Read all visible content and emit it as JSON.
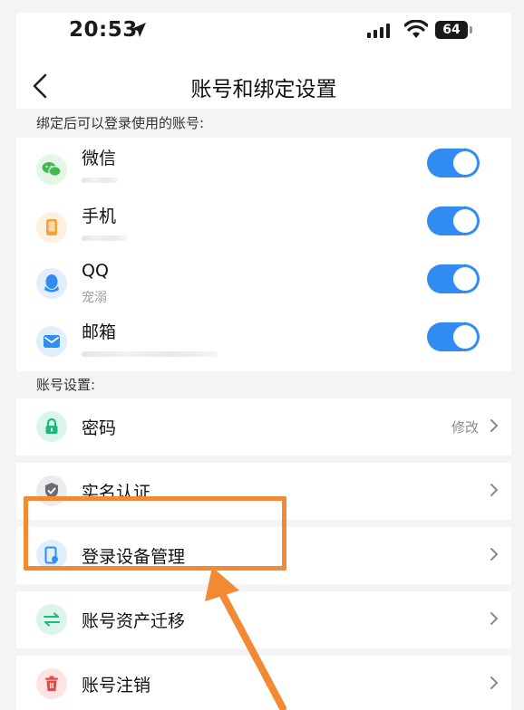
{
  "status_bar": {
    "time": "20:53",
    "battery": "64"
  },
  "nav": {
    "title": "账号和绑定设置"
  },
  "bind_section": {
    "header": "绑定后可以登录使用的账号:",
    "items": [
      {
        "name": "微信",
        "sub": "",
        "icon": "wechat-icon",
        "color": "#3fb950",
        "enabled": true
      },
      {
        "name": "手机",
        "sub": "",
        "icon": "phone-icon",
        "color": "#f0a33a",
        "enabled": true
      },
      {
        "name": "QQ",
        "sub": "宠溺",
        "icon": "qq-icon",
        "color": "#2f8cf2",
        "enabled": true
      },
      {
        "name": "邮箱",
        "sub": "",
        "icon": "mail-icon",
        "color": "#2f8cf2",
        "enabled": true
      }
    ]
  },
  "account_section": {
    "header": "账号设置:",
    "items": [
      {
        "label": "密码",
        "value": "修改",
        "icon": "lock-icon",
        "color": "#1fb87a"
      },
      {
        "label": "实名认证",
        "value": "",
        "icon": "shield-icon",
        "color": "#6b6f75"
      },
      {
        "label": "登录设备管理",
        "value": "",
        "icon": "device-icon",
        "color": "#2f8cf2"
      },
      {
        "label": "账号资产迁移",
        "value": "",
        "icon": "transfer-icon",
        "color": "#1fb87a"
      },
      {
        "label": "账号注销",
        "value": "",
        "icon": "trash-icon",
        "color": "#e24a4a"
      }
    ]
  },
  "colors": {
    "accent": "#2f8cf2",
    "annotation": "#f28a34"
  }
}
